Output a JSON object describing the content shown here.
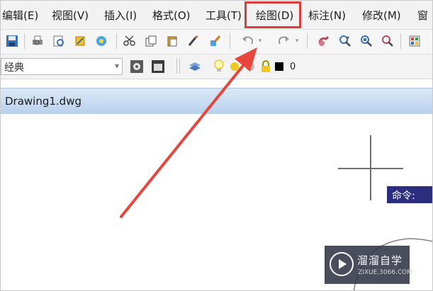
{
  "menubar": {
    "items": [
      "编辑(E)",
      "视图(V)",
      "插入(I)",
      "格式(O)",
      "工具(T)",
      "绘图(D)",
      "标注(N)",
      "修改(M)",
      "窗"
    ],
    "highlight_color": "#e03b3b"
  },
  "toolbar1": {
    "icons": [
      "save-icon",
      "print-icon",
      "print-preview-icon",
      "publish-icon",
      "plot-icon",
      "cut-icon",
      "copy-icon",
      "paste-icon",
      "match-properties-icon",
      "block-editor-icon",
      "undo-icon",
      "redo-icon",
      "pan-icon",
      "zoom-realtime-icon",
      "zoom-window-icon",
      "zoom-previous-icon",
      "properties-icon"
    ]
  },
  "toolbar2": {
    "style_combo_value": "经典",
    "layer_value": "0",
    "icons": [
      "workspace-settings-icon",
      "toolbar-lock-icon",
      "layer-manager-icon",
      "light-bulb-icon",
      "sun-icon",
      "freeze-icon",
      "lock-icon",
      "color-swatch-icon"
    ]
  },
  "tab": {
    "label": "Drawing1.dwg",
    "gradient_top": "#dce9f8",
    "gradient_bottom": "#b9d1ec"
  },
  "canvas": {
    "command_tooltip": "命令:",
    "tooltip_bg": "#2d2d80"
  },
  "watermark": {
    "name": "溜溜自学",
    "url": "ZIXUE.3066.COM"
  },
  "annotation": {
    "arrow_color": "#e8453c",
    "highlighted_menu": "绘图(D)"
  }
}
